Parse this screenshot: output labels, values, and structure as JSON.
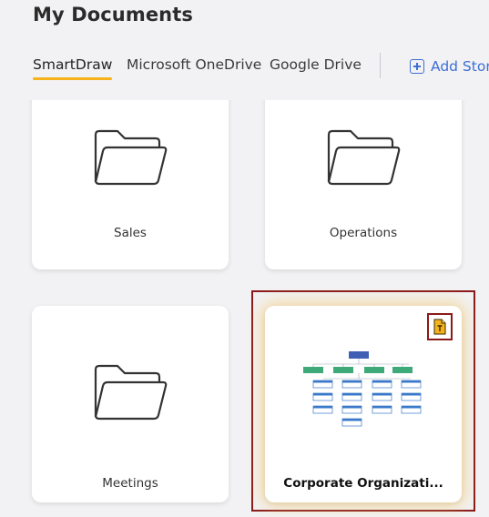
{
  "header": {
    "title": "My Documents"
  },
  "tabs": [
    {
      "label": "SmartDraw",
      "active": true
    },
    {
      "label": "Microsoft OneDrive",
      "active": false
    },
    {
      "label": "Google Drive",
      "active": false
    }
  ],
  "add_storage": {
    "label": "Add Stora",
    "icon": "plus-square-icon"
  },
  "items": [
    {
      "type": "folder",
      "name": "Sales",
      "icon": "folder-icon"
    },
    {
      "type": "folder",
      "name": "Operations",
      "icon": "folder-icon"
    },
    {
      "type": "folder",
      "name": "Meetings",
      "icon": "folder-icon"
    },
    {
      "type": "document",
      "name": "Corporate Organizati...",
      "badge_icon": "template-file-icon",
      "selected": true
    }
  ],
  "colors": {
    "accent_tab": "#f6b21b",
    "link": "#3d6fd6",
    "selection": "#8a1a1a",
    "badge": "#f6b21b"
  }
}
